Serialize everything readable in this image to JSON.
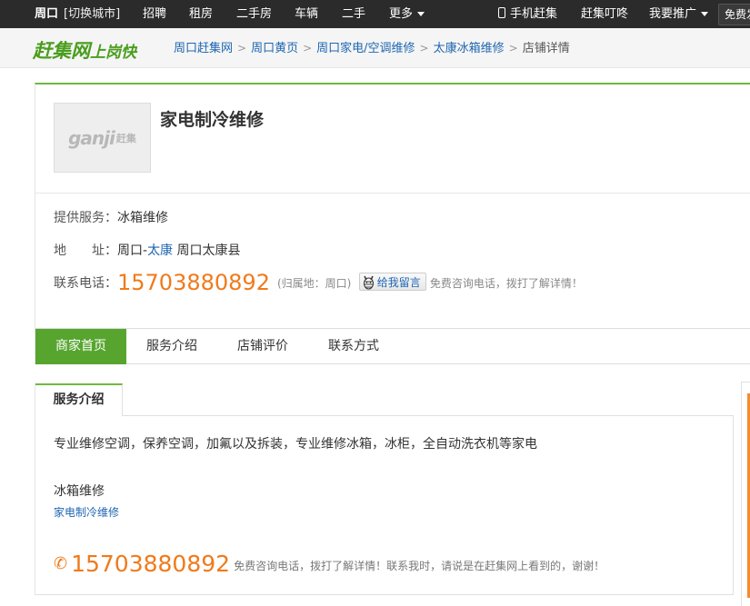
{
  "topbar": {
    "city": "周口",
    "switch_city": "[切换城市]",
    "nav": [
      "招聘",
      "租房",
      "二手房",
      "车辆",
      "二手",
      "更多"
    ],
    "mobile": "手机赶集",
    "dingdong": "赶集叮咚",
    "promote": "我要推广",
    "free": "免费发"
  },
  "header": {
    "logo_main": "赶集网",
    "logo_sub": "上岗快",
    "breadcrumb": [
      "周口赶集网",
      "周口黄页",
      "周口家电/空调维修",
      "太康冰箱维修",
      "店铺详情"
    ]
  },
  "shop": {
    "logo_text": "ganji",
    "logo_sub": "赶集",
    "name": "家电制冷维修",
    "service_label": "提供服务：",
    "service_value": "冰箱维修",
    "address_label": "地　　址：",
    "address_city": "周口-",
    "address_district": "太康",
    "address_rest": " 周口太康县",
    "phone_label": "联系电话：",
    "phone": "15703880892",
    "phone_attr": "(归属地：周口)",
    "message_button": "给我留言",
    "free_tip": "免费咨询电话，拨打了解详情！"
  },
  "tabs": [
    "商家首页",
    "服务介绍",
    "店铺评价",
    "联系方式"
  ],
  "section": {
    "title": "服务介绍",
    "description": "专业维修空调，保养空调，加氟以及拆装，专业维修冰箱，冰柜，全自动洗衣机等家电",
    "service_name": "冰箱维修",
    "service_link": "家电制冷维修",
    "phone": "15703880892",
    "tip": "免费咨询电话，拨打了解详情！联系我时，请说是在赶集网上看到的，谢谢！"
  },
  "colors": {
    "green": "#57a52f",
    "orange": "#f07a1a",
    "link": "#1e66b1"
  }
}
